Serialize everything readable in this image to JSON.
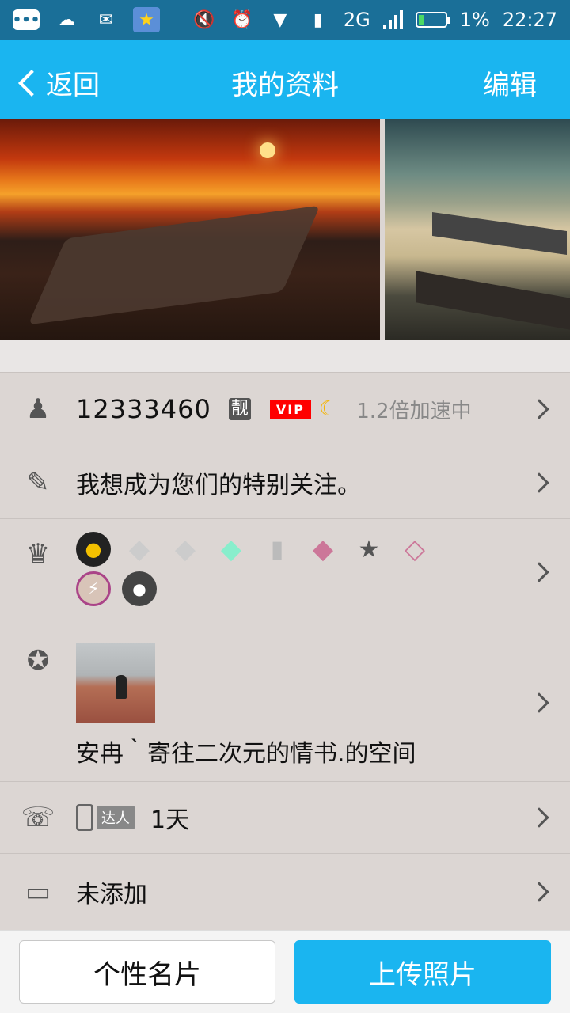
{
  "status_bar": {
    "network": "2G",
    "battery_percent": "1%",
    "time": "22:27"
  },
  "header": {
    "back_label": "返回",
    "title": "我的资料",
    "edit_label": "编辑"
  },
  "profile": {
    "qq_number": "12333460",
    "liang_badge": "靓",
    "vip_badge": "VIP",
    "speed_text": "1.2倍加速中",
    "signature": "我想成为您们的特别关注。",
    "qzone_name": "安冉｀寄往二次元的情书.的空间",
    "daren_tag": "达人",
    "daren_days": "1天",
    "card_status": "未添加",
    "badges": [
      {
        "icon": "qq-penguin-icon",
        "glyph": "●"
      },
      {
        "icon": "diamond-icon",
        "glyph": "◆"
      },
      {
        "icon": "diamond-lv1-icon",
        "glyph": "◆"
      },
      {
        "icon": "diamond-green-icon",
        "glyph": "◆"
      },
      {
        "icon": "book-icon",
        "glyph": "▮"
      },
      {
        "icon": "diamond-pink-icon",
        "glyph": "◆"
      },
      {
        "icon": "star-icon",
        "glyph": "★"
      },
      {
        "icon": "diamond-pink-outline-icon",
        "glyph": "◇"
      },
      {
        "icon": "lightning-icon",
        "glyph": "⚡"
      },
      {
        "icon": "bird-icon",
        "glyph": "●"
      }
    ]
  },
  "buttons": {
    "card_label": "个性名片",
    "upload_label": "上传照片"
  },
  "colors": {
    "status_bar": "#1a6f98",
    "title_bar": "#1ab5f0",
    "vip_red": "#ff0000"
  }
}
